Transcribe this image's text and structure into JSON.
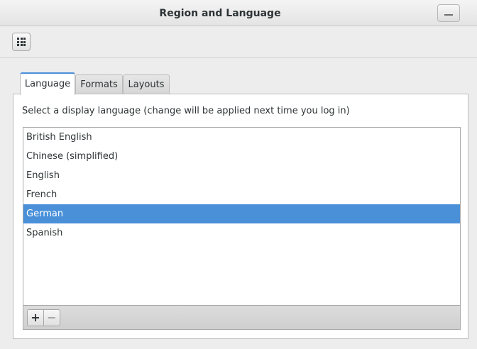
{
  "window": {
    "title": "Region and Language"
  },
  "tabs": [
    {
      "label": "Language",
      "active": true
    },
    {
      "label": "Formats",
      "active": false
    },
    {
      "label": "Layouts",
      "active": false
    }
  ],
  "language_panel": {
    "instruction": "Select a display language (change will be applied next time you log in)",
    "languages": [
      {
        "label": "British English",
        "selected": false
      },
      {
        "label": "Chinese (simplified)",
        "selected": false
      },
      {
        "label": "English",
        "selected": false
      },
      {
        "label": "French",
        "selected": false
      },
      {
        "label": "German",
        "selected": true
      },
      {
        "label": "Spanish",
        "selected": false
      }
    ],
    "add_label": "+",
    "remove_label": "−"
  },
  "icons": {
    "overview": "grid-icon",
    "window_control": "minimize-icon"
  },
  "colors": {
    "accent": "#4a90d9",
    "background": "#ededed",
    "text": "#2e3436"
  }
}
